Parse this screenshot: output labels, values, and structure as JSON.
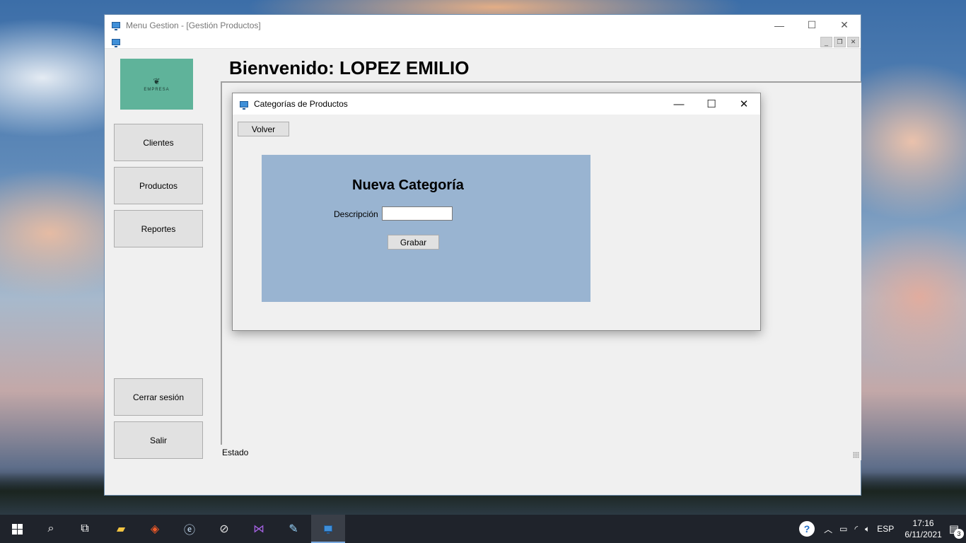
{
  "main_window": {
    "title": "Menu Gestion - [Gestión Productos]",
    "controls": {
      "minimize": "—",
      "maximize": "☐",
      "close": "✕"
    },
    "mdi_controls": {
      "minimize": "_",
      "restore": "❐",
      "close": "✕"
    }
  },
  "logo": {
    "text": "EMPRESA",
    "icon": "leaf-icon"
  },
  "welcome": "Bienvenido: LOPEZ EMILIO",
  "sidebar": {
    "buttons": [
      {
        "label": "Clientes"
      },
      {
        "label": "Productos"
      },
      {
        "label": "Reportes"
      }
    ],
    "bottom_buttons": [
      {
        "label": "Cerrar sesión"
      },
      {
        "label": "Salir"
      }
    ]
  },
  "status_bar": {
    "text": "Estado"
  },
  "child_window": {
    "title": "Categorías de Productos",
    "controls": {
      "minimize": "—",
      "maximize": "☐",
      "close": "✕"
    },
    "back_button": "Volver",
    "form": {
      "title": "Nueva Categoría",
      "description_label": "Descripción",
      "description_value": "",
      "save_button": "Grabar"
    },
    "panel_color": "#99b4d1"
  },
  "taskbar": {
    "apps": [
      "start-icon",
      "search-icon",
      "task-view-icon",
      "file-explorer-icon",
      "brave-icon",
      "browser-icon",
      "compass-icon",
      "visual-studio-icon",
      "paint-icon",
      "app-window-icon"
    ],
    "language": "ESP",
    "time": "17:16",
    "date": "6/11/2021",
    "notifications": "3"
  }
}
